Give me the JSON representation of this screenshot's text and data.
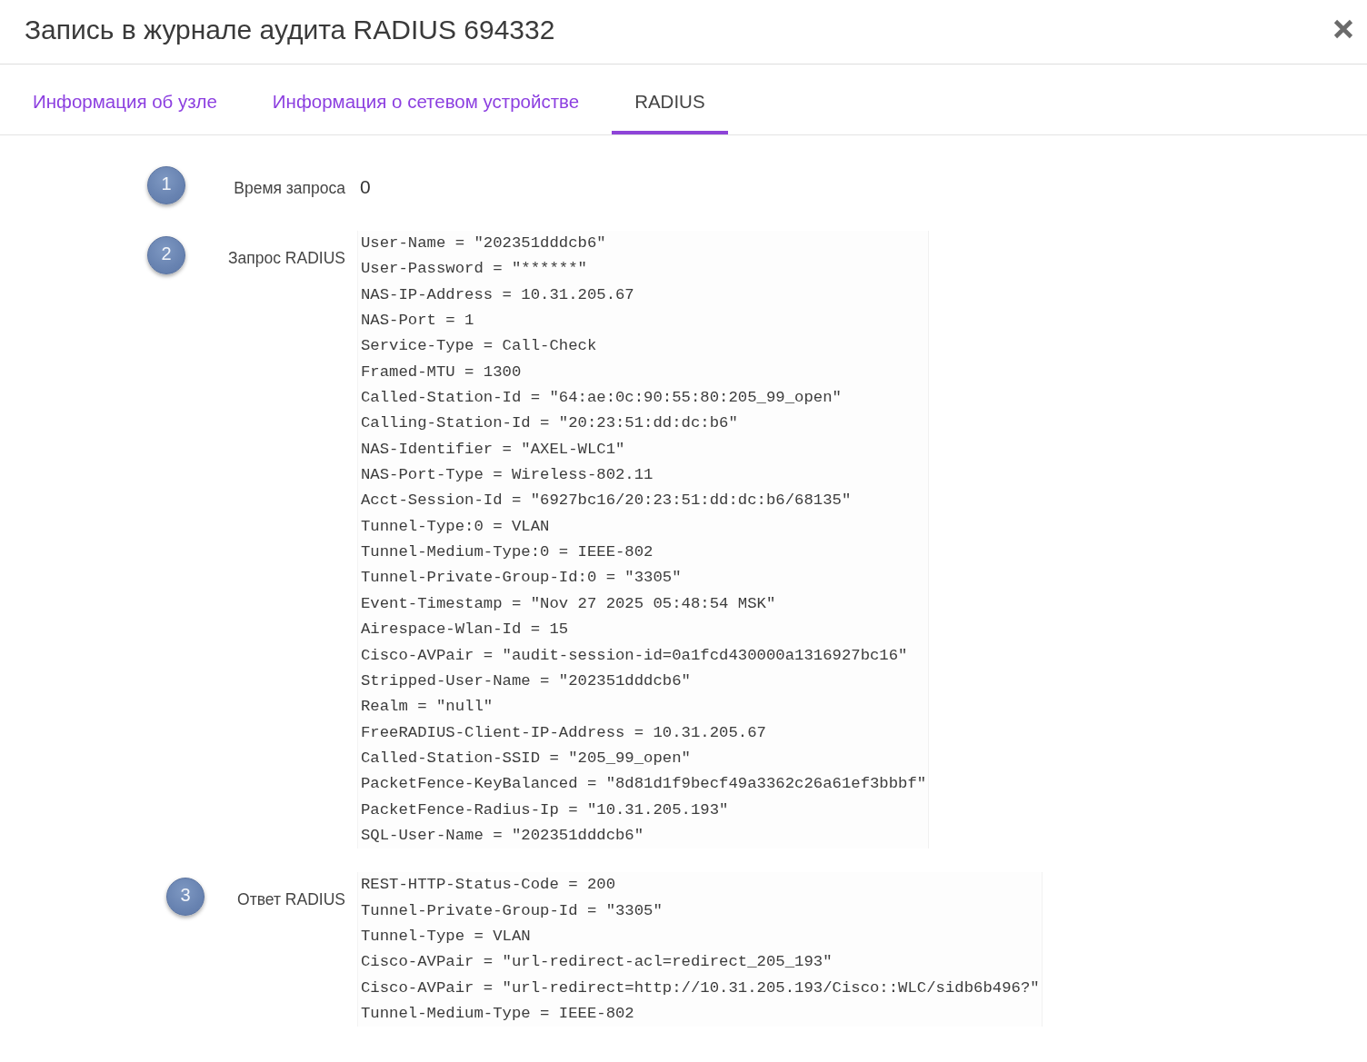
{
  "dialog": {
    "title": "Запись в журнале аудита RADIUS 694332"
  },
  "tabs": [
    {
      "label": "Информация об узле",
      "selected": false
    },
    {
      "label": "Информация о сетевом устройстве",
      "selected": false
    },
    {
      "label": "RADIUS",
      "selected": true
    }
  ],
  "entries": [
    {
      "number": "1",
      "label": "Время запроса",
      "kind": "value",
      "value": "0"
    },
    {
      "number": "2",
      "label": "Запрос RADIUS",
      "kind": "attributes",
      "lines": [
        "User-Name = \"202351dddcb6\"",
        "User-Password = \"******\"",
        "NAS-IP-Address = 10.31.205.67",
        "NAS-Port = 1",
        "Service-Type = Call-Check",
        "Framed-MTU = 1300",
        "Called-Station-Id = \"64:ae:0c:90:55:80:205_99_open\"",
        "Calling-Station-Id = \"20:23:51:dd:dc:b6\"",
        "NAS-Identifier = \"AXEL-WLC1\"",
        "NAS-Port-Type = Wireless-802.11",
        "Acct-Session-Id = \"6927bc16/20:23:51:dd:dc:b6/68135\"",
        "Tunnel-Type:0 = VLAN",
        "Tunnel-Medium-Type:0 = IEEE-802",
        "Tunnel-Private-Group-Id:0 = \"3305\"",
        "Event-Timestamp = \"Nov 27 2025 05:48:54 MSK\"",
        "Airespace-Wlan-Id = 15",
        "Cisco-AVPair = \"audit-session-id=0a1fcd430000a1316927bc16\"",
        "Stripped-User-Name = \"202351dddcb6\"",
        "Realm = \"null\"",
        "FreeRADIUS-Client-IP-Address = 10.31.205.67",
        "Called-Station-SSID = \"205_99_open\"",
        "PacketFence-KeyBalanced = \"8d81d1f9becf49a3362c26a61ef3bbbf\"",
        "PacketFence-Radius-Ip = \"10.31.205.193\"",
        "SQL-User-Name = \"202351dddcb6\""
      ]
    },
    {
      "number": "3",
      "label": "Ответ RADIUS",
      "kind": "attributes",
      "lines": [
        "REST-HTTP-Status-Code = 200",
        "Tunnel-Private-Group-Id = \"3305\"",
        "Tunnel-Type = VLAN",
        "Cisco-AVPair = \"url-redirect-acl=redirect_205_193\"",
        "Cisco-AVPair = \"url-redirect=http://10.31.205.193/Cisco::WLC/sidb6b496?\"",
        "Tunnel-Medium-Type = IEEE-802"
      ]
    }
  ]
}
